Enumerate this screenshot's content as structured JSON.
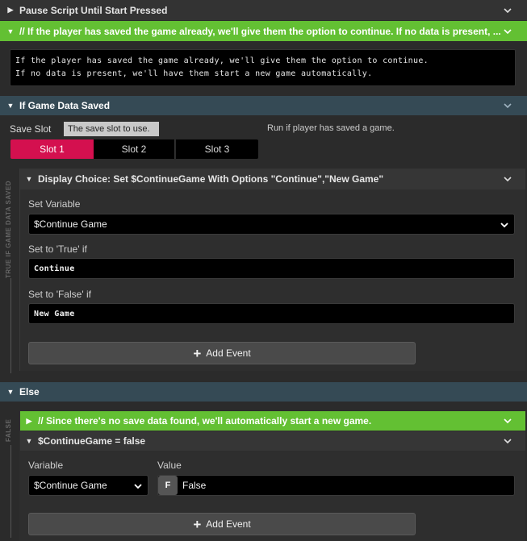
{
  "header_pause": {
    "label": "Pause Script Until Start Pressed"
  },
  "comment1": {
    "label": "// If the player has saved the game already, we'll give them the option to continue. If no data is present, ...",
    "line1": "If the player has saved the game already, we'll give them the option to continue.",
    "line2": "If no data is present, we'll have them start a new game automatically."
  },
  "if_saved": {
    "label": "If Game Data Saved",
    "save_slot_label": "Save Slot",
    "tooltip": "The save slot to use.",
    "run_note": "Run if player has saved a game.",
    "slots": [
      "Slot 1",
      "Slot 2",
      "Slot 3"
    ],
    "selected_slot": "Slot 1",
    "branch_label": "TRUE   IF GAME DATA SAVED"
  },
  "display_choice": {
    "label": "Display Choice: Set $ContinueGame With Options \"Continue\",\"New Game\"",
    "set_variable_label": "Set Variable",
    "set_variable_value": "$Continue Game",
    "true_label": "Set to 'True' if",
    "true_value": "Continue",
    "false_label": "Set to 'False' if",
    "false_value": "New Game",
    "add_event": "Add Event"
  },
  "else_block": {
    "label": "Else",
    "branch_label": "FALSE",
    "comment": "// Since there's no save data found, we'll automatically start a new game.",
    "set_false": {
      "label": "$ContinueGame = false",
      "variable_label": "Variable",
      "variable_value": "$Continue Game",
      "value_label": "Value",
      "value_badge": "F",
      "value_text": "False",
      "add_event": "Add Event"
    }
  },
  "colors": {
    "green": "#63c033",
    "teal_header": "#354a55",
    "pink": "#d4104f",
    "background": "#2b2b2b"
  },
  "icons": [
    "chevron-down-icon",
    "triangle-right-icon",
    "triangle-down-icon",
    "plus-icon"
  ]
}
